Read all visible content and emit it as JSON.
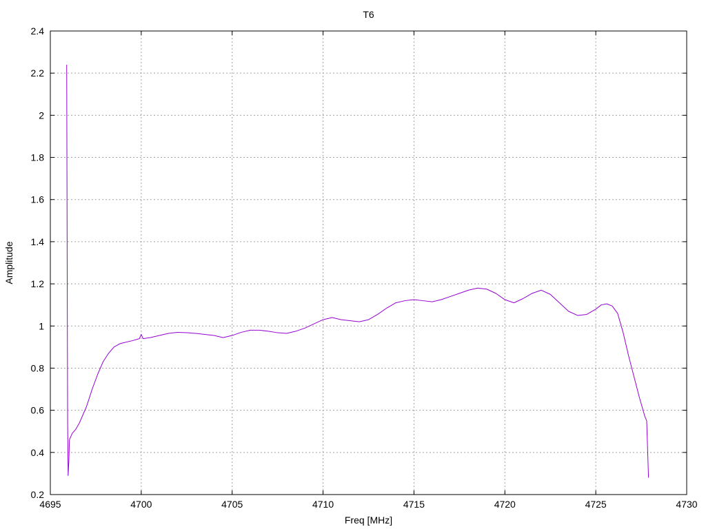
{
  "chart_data": {
    "type": "line",
    "title": "T6",
    "xlabel": "Freq [MHz]",
    "ylabel": "Amplitude",
    "xlim": [
      4695,
      4730
    ],
    "ylim": [
      0.2,
      2.4
    ],
    "x_ticks": [
      4695,
      4700,
      4705,
      4710,
      4715,
      4720,
      4725,
      4730
    ],
    "y_ticks": [
      0.2,
      0.4,
      0.6,
      0.8,
      1,
      1.2,
      1.4,
      1.6,
      1.8,
      2,
      2.2,
      2.4
    ],
    "grid": true,
    "legend": "none",
    "series": [
      {
        "color": "#9400d3",
        "x": [
          4695.9,
          4695.92,
          4695.95,
          4695.98,
          4696.02,
          4696.05,
          4696.1,
          4696.2,
          4696.4,
          4696.6,
          4696.8,
          4697.0,
          4697.3,
          4697.6,
          4697.9,
          4698.2,
          4698.5,
          4698.8,
          4699.0,
          4699.5,
          4699.9,
          4700.0,
          4700.1,
          4700.5,
          4701.0,
          4701.5,
          4702.0,
          4702.5,
          4703.0,
          4703.5,
          4704.0,
          4704.5,
          4705.0,
          4705.5,
          4706.0,
          4706.5,
          4707.0,
          4707.5,
          4708.0,
          4708.5,
          4709.0,
          4709.5,
          4710.0,
          4710.5,
          4711.0,
          4711.5,
          4712.0,
          4712.5,
          4713.0,
          4713.5,
          4714.0,
          4714.5,
          4715.0,
          4715.5,
          4716.0,
          4716.5,
          4717.0,
          4717.5,
          4718.0,
          4718.5,
          4719.0,
          4719.5,
          4720.0,
          4720.5,
          4721.0,
          4721.5,
          4722.0,
          4722.5,
          4723.0,
          4723.5,
          4724.0,
          4724.5,
          4725.0,
          4725.3,
          4725.6,
          4725.9,
          4726.2,
          4726.5,
          4726.8,
          4727.1,
          4727.4,
          4727.6,
          4727.7,
          4727.8,
          4727.9
        ],
        "y": [
          2.24,
          1.53,
          0.55,
          0.29,
          0.36,
          0.46,
          0.47,
          0.49,
          0.51,
          0.54,
          0.58,
          0.62,
          0.7,
          0.77,
          0.83,
          0.87,
          0.9,
          0.915,
          0.92,
          0.93,
          0.94,
          0.96,
          0.94,
          0.945,
          0.955,
          0.965,
          0.97,
          0.968,
          0.965,
          0.96,
          0.955,
          0.945,
          0.955,
          0.97,
          0.98,
          0.98,
          0.975,
          0.968,
          0.965,
          0.975,
          0.99,
          1.01,
          1.03,
          1.04,
          1.03,
          1.025,
          1.02,
          1.03,
          1.055,
          1.085,
          1.11,
          1.12,
          1.125,
          1.12,
          1.115,
          1.125,
          1.14,
          1.155,
          1.17,
          1.18,
          1.175,
          1.155,
          1.125,
          1.11,
          1.13,
          1.155,
          1.17,
          1.15,
          1.11,
          1.07,
          1.05,
          1.055,
          1.08,
          1.1,
          1.105,
          1.095,
          1.06,
          0.97,
          0.86,
          0.76,
          0.66,
          0.6,
          0.57,
          0.55,
          0.28
        ]
      }
    ]
  }
}
